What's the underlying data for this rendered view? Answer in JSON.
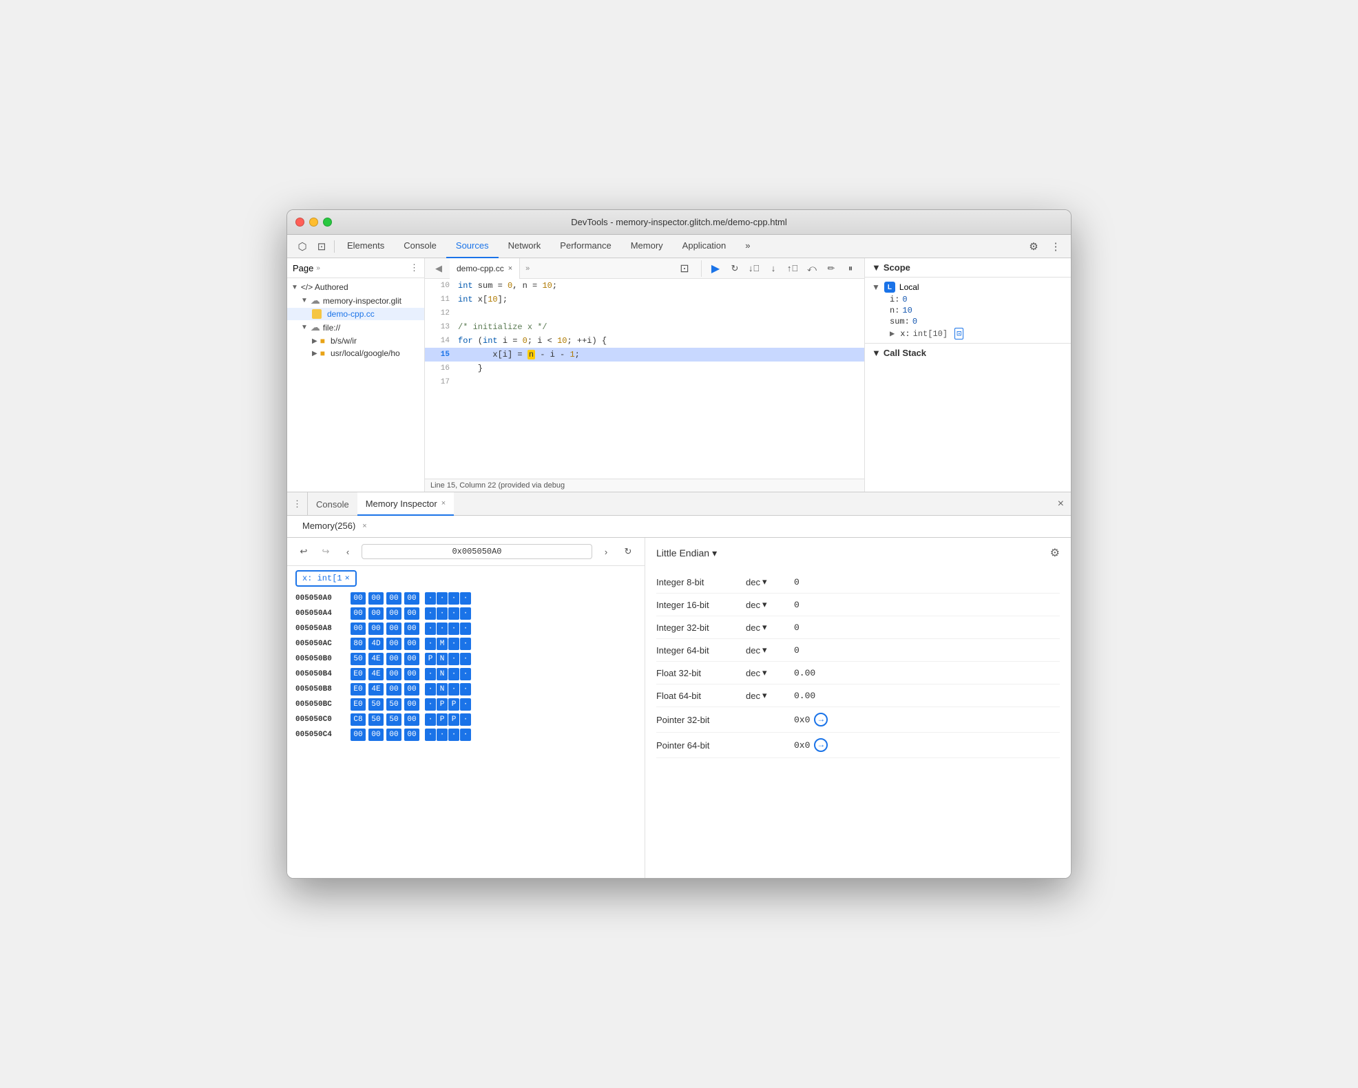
{
  "window": {
    "title": "DevTools - memory-inspector.glitch.me/demo-cpp.html"
  },
  "title_bar": {
    "title": "DevTools - memory-inspector.glitch.me/demo-cpp.html"
  },
  "toolbar": {
    "tabs": [
      {
        "id": "elements",
        "label": "Elements",
        "active": false
      },
      {
        "id": "console",
        "label": "Console",
        "active": false
      },
      {
        "id": "sources",
        "label": "Sources",
        "active": true
      },
      {
        "id": "network",
        "label": "Network",
        "active": false
      },
      {
        "id": "performance",
        "label": "Performance",
        "active": false
      },
      {
        "id": "memory",
        "label": "Memory",
        "active": false
      },
      {
        "id": "application",
        "label": "Application",
        "active": false
      }
    ]
  },
  "sidebar": {
    "header": "Page",
    "items": [
      {
        "label": "Authored",
        "type": "group",
        "expanded": true,
        "indent": 0
      },
      {
        "label": "memory-inspector.glit",
        "type": "cloud",
        "expanded": true,
        "indent": 1
      },
      {
        "label": "demo-cpp.cc",
        "type": "file",
        "selected": true,
        "indent": 2
      },
      {
        "label": "file://",
        "type": "cloud",
        "expanded": true,
        "indent": 1
      },
      {
        "label": "b/s/w/ir",
        "type": "folder",
        "indent": 2
      },
      {
        "label": "usr/local/google/ho",
        "type": "folder",
        "indent": 2
      }
    ]
  },
  "code": {
    "filename": "demo-cpp.cc",
    "lines": [
      {
        "num": 10,
        "text": "    int sum = 0, n = 10;",
        "highlighted": false
      },
      {
        "num": 11,
        "text": "    int x[10];",
        "highlighted": false
      },
      {
        "num": 12,
        "text": "",
        "highlighted": false
      },
      {
        "num": 13,
        "text": "    /* initialize x */",
        "highlighted": false
      },
      {
        "num": 14,
        "text": "    for (int i = 0; i < 10; ++i) {",
        "highlighted": false
      },
      {
        "num": 15,
        "text": "        x[i] = n - i - 1;",
        "highlighted": true
      },
      {
        "num": 16,
        "text": "    }",
        "highlighted": false
      },
      {
        "num": 17,
        "text": "",
        "highlighted": false
      }
    ],
    "status": "Line 15, Column 22 (provided via debug"
  },
  "scope": {
    "title": "Scope",
    "local_label": "Local",
    "vars": [
      {
        "key": "i:",
        "val": "0",
        "type": "num"
      },
      {
        "key": "n:",
        "val": "10",
        "type": "num"
      },
      {
        "key": "sum:",
        "val": "0",
        "type": "num"
      },
      {
        "key": "x:",
        "val": "int[10]",
        "type": "array",
        "has_memory_icon": true
      }
    ],
    "call_stack_title": "Call Stack"
  },
  "debug_toolbar": {
    "buttons": [
      {
        "id": "resume",
        "icon": "▶",
        "active": true
      },
      {
        "id": "step-over",
        "icon": "↻"
      },
      {
        "id": "step-into",
        "icon": "↓"
      },
      {
        "id": "step-out",
        "icon": "↑"
      },
      {
        "id": "deactivate",
        "icon": "⤺"
      },
      {
        "id": "disable",
        "icon": "✏"
      },
      {
        "id": "pause",
        "icon": "⏸"
      }
    ]
  },
  "bottom_tabs": [
    {
      "id": "console",
      "label": "Console",
      "active": false,
      "closeable": false
    },
    {
      "id": "memory-inspector",
      "label": "Memory Inspector",
      "active": true,
      "closeable": true
    }
  ],
  "memory_sub_tabs": [
    {
      "id": "memory-256",
      "label": "Memory(256)",
      "active": true,
      "closeable": true
    }
  ],
  "memory_nav": {
    "address": "0x005050A0",
    "tag": "x: int[1"
  },
  "endian": {
    "label": "Little Endian"
  },
  "inspector_rows": [
    {
      "label": "Integer 8-bit",
      "format": "dec",
      "value": "0"
    },
    {
      "label": "Integer 16-bit",
      "format": "dec",
      "value": "0"
    },
    {
      "label": "Integer 32-bit",
      "format": "dec",
      "value": "0"
    },
    {
      "label": "Integer 64-bit",
      "format": "dec",
      "value": "0"
    },
    {
      "label": "Float 32-bit",
      "format": "dec",
      "value": "0.00"
    },
    {
      "label": "Float 64-bit",
      "format": "dec",
      "value": "0.00"
    },
    {
      "label": "Pointer 32-bit",
      "format": null,
      "value": "0x0",
      "is_ptr": true
    },
    {
      "label": "Pointer 64-bit",
      "format": null,
      "value": "0x0",
      "is_ptr": true
    }
  ],
  "hex_rows": [
    {
      "addr": "005050A0",
      "highlight": true,
      "bytes": [
        "00",
        "00",
        "00",
        "00"
      ],
      "ascii": [
        "·",
        "·",
        "·",
        "·"
      ],
      "selected": [
        true,
        true,
        true,
        true
      ]
    },
    {
      "addr": "005050A4",
      "highlight": false,
      "bytes": [
        "00",
        "00",
        "00",
        "00"
      ],
      "ascii": [
        "·",
        "·",
        "·",
        "·"
      ],
      "selected": [
        true,
        true,
        true,
        true
      ]
    },
    {
      "addr": "005050A8",
      "highlight": false,
      "bytes": [
        "00",
        "00",
        "00",
        "00"
      ],
      "ascii": [
        "·",
        "·",
        "·",
        "·"
      ],
      "selected": [
        true,
        true,
        true,
        true
      ]
    },
    {
      "addr": "005050AC",
      "highlight": false,
      "bytes": [
        "80",
        "4D",
        "00",
        "00"
      ],
      "ascii": [
        "·",
        "M",
        "·",
        "·"
      ],
      "selected": [
        true,
        true,
        true,
        true
      ]
    },
    {
      "addr": "005050B0",
      "highlight": false,
      "bytes": [
        "50",
        "4E",
        "00",
        "00"
      ],
      "ascii": [
        "P",
        "N",
        "·",
        "·"
      ],
      "selected": [
        true,
        true,
        true,
        true
      ]
    },
    {
      "addr": "005050B4",
      "highlight": false,
      "bytes": [
        "E0",
        "4E",
        "00",
        "00"
      ],
      "ascii": [
        "·",
        "N",
        "·",
        "·"
      ],
      "selected": [
        true,
        true,
        true,
        true
      ]
    },
    {
      "addr": "005050B8",
      "highlight": false,
      "bytes": [
        "E0",
        "4E",
        "00",
        "00"
      ],
      "ascii": [
        "·",
        "N",
        "·",
        "·"
      ],
      "selected": [
        true,
        true,
        true,
        true
      ]
    },
    {
      "addr": "005050BC",
      "highlight": false,
      "bytes": [
        "E0",
        "50",
        "50",
        "00"
      ],
      "ascii": [
        "·",
        "P",
        "P",
        "·"
      ],
      "selected": [
        true,
        true,
        true,
        true
      ]
    },
    {
      "addr": "005050C0",
      "highlight": false,
      "bytes": [
        "C8",
        "50",
        "50",
        "00"
      ],
      "ascii": [
        "·",
        "P",
        "P",
        "·"
      ],
      "selected": [
        true,
        true,
        true,
        true
      ]
    },
    {
      "addr": "005050C4",
      "highlight": false,
      "bytes": [
        "00",
        "00",
        "00",
        "00"
      ],
      "ascii": [
        "·",
        "·",
        "·",
        "·"
      ],
      "selected": [
        true,
        true,
        true,
        true
      ]
    }
  ],
  "icons": {
    "cursor": "⬡",
    "more_vert": "⋮",
    "chevron_right": "»",
    "close": "×",
    "gear": "⚙",
    "refresh": "↻",
    "back": "↩",
    "forward": "↪",
    "left": "‹",
    "right": "›",
    "arrow_circle": "→",
    "triangle_down": "▾",
    "triangle_right": "▶"
  }
}
